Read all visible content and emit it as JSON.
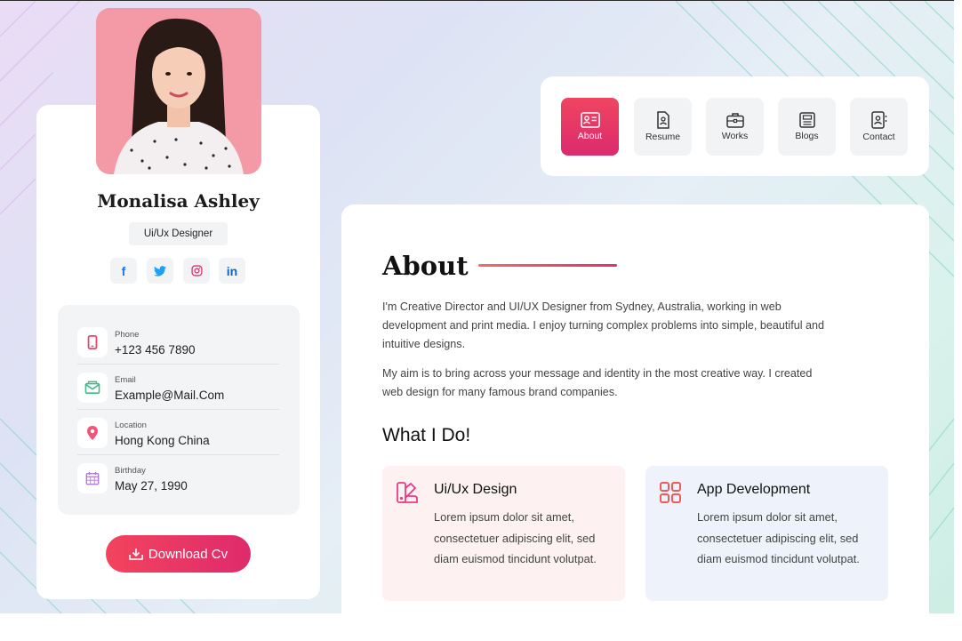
{
  "profile": {
    "name": "Monalisa Ashley",
    "role": "Ui/Ux Designer",
    "social": [
      {
        "icon": "facebook-icon",
        "glyph": "f",
        "color": "#1877f2"
      },
      {
        "icon": "twitter-icon",
        "glyph": "🐦",
        "color": "#1da1f2"
      },
      {
        "icon": "instagram-icon",
        "glyph": "◎",
        "color": "#e1306c"
      },
      {
        "icon": "linkedin-icon",
        "glyph": "in",
        "color": "#0a66c2"
      }
    ],
    "contacts": [
      {
        "label": "Phone",
        "value": "+123 456 7890",
        "icon": "phone-icon",
        "color": "#e9456a"
      },
      {
        "label": "Email",
        "value": "Example@Mail.Com",
        "icon": "email-icon",
        "color": "#47b88a"
      },
      {
        "label": "Location",
        "value": "Hong Kong China",
        "icon": "location-icon",
        "color": "#f2557a"
      },
      {
        "label": "Birthday",
        "value": "May 27, 1990",
        "icon": "calendar-icon",
        "color": "#b07ad6"
      }
    ],
    "download_label": "Download Cv"
  },
  "nav": {
    "items": [
      {
        "label": "About",
        "icon": "about-icon",
        "active": true
      },
      {
        "label": "Resume",
        "icon": "resume-icon",
        "active": false
      },
      {
        "label": "Works",
        "icon": "briefcase-icon",
        "active": false
      },
      {
        "label": "Blogs",
        "icon": "blog-icon",
        "active": false
      },
      {
        "label": "Contact",
        "icon": "contact-icon",
        "active": false
      }
    ]
  },
  "about": {
    "title": "About",
    "paragraphs": [
      "I'm Creative Director and UI/UX Designer from Sydney, Australia, working in web development and print media. I enjoy turning complex problems into simple, beautiful and intuitive designs.",
      "My aim is to bring across your message and identity in the most creative way. I created web design for many famous brand companies."
    ],
    "what_i_do": "What I Do!",
    "services": [
      {
        "title": "Ui/Ux Design",
        "desc": "Lorem ipsum dolor sit amet, consectetuer adipiscing elit, sed diam euismod tincidunt volutpat.",
        "icon": "design-icon",
        "color": "#ec3b83",
        "bg": "#fdf1f1"
      },
      {
        "title": "App Development",
        "desc": "Lorem ipsum dolor sit amet, consectetuer adipiscing elit, sed diam euismod tincidunt volutpat.",
        "icon": "apps-grid-icon",
        "color": "#ef5a5a",
        "bg": "#eef3fb"
      }
    ]
  },
  "colors": {
    "accent": "#e8365f",
    "accent_end": "#dc2a6e"
  }
}
